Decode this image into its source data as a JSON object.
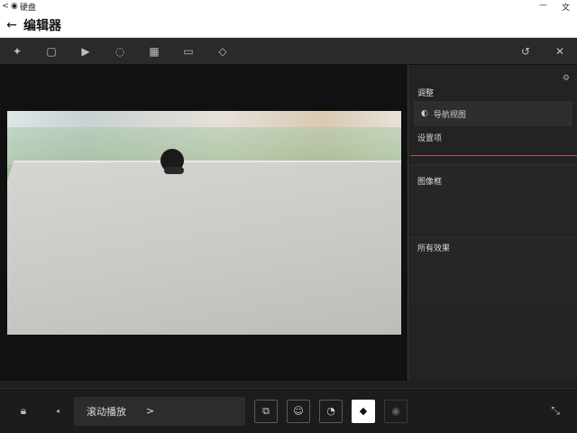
{
  "titlebar": {
    "back_icon": "back-arrow",
    "app_label": "硬盘",
    "close_label": "文"
  },
  "header": {
    "title": "编辑器"
  },
  "toolbar": {
    "icons": [
      "wand-icon",
      "folder-icon",
      "video-icon",
      "circle-icon",
      "film-icon",
      "box-icon",
      "tag-icon"
    ],
    "right_icons": [
      "history-icon",
      "close-icon"
    ]
  },
  "panel": {
    "label1": "调整",
    "field_text": "导航视图",
    "label2": "设置项",
    "label3": "图像框",
    "label4": "所有效果"
  },
  "bottombar": {
    "slot_text": "滚动播放",
    "slot_arrow": ">",
    "buttons": [
      "crop-icon",
      "person-icon",
      "face-icon",
      "diamond-icon",
      "eye-icon"
    ],
    "expand_icon": "expand-icon"
  }
}
